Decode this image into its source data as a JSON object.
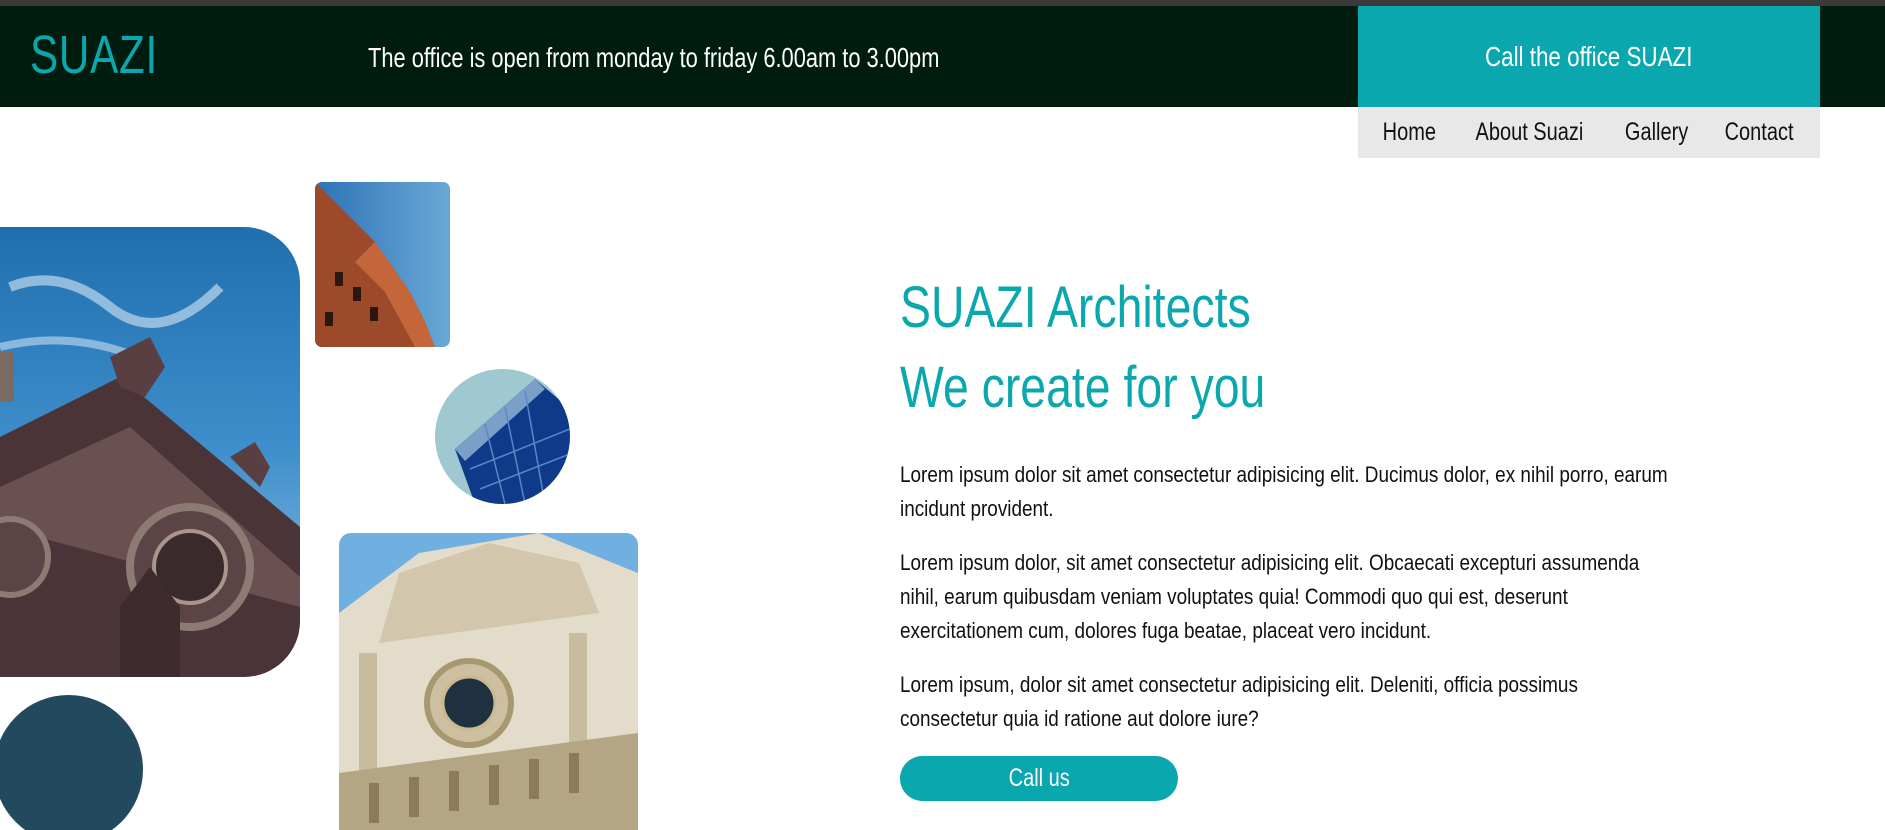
{
  "header": {
    "logo": "SUAZI",
    "hours": "The office is open from monday to friday 6.00am to 3.00pm",
    "call_office": "Call the office SUAZI"
  },
  "nav": {
    "items": [
      "Home",
      "About Suazi",
      "Gallery",
      "Contact"
    ]
  },
  "hero": {
    "title_line1": "SUAZI Architects",
    "title_line2": "We create for you",
    "paragraphs": [
      "Lorem ipsum dolor sit amet consectetur adipisicing elit. Ducimus dolor, ex nihil porro, earum incidunt provident.",
      "Lorem ipsum dolor, sit amet consectetur adipisicing elit. Obcaecati excepturi assumenda nihil, earum quibusdam veniam voluptates quia! Commodi quo qui est, deserunt exercitationem cum, dolores fuga beatae, placeat vero incidunt.",
      "Lorem ipsum, dolor sit amet consectetur adipisicing elit. Deleniti, officia possimus consectetur quia id ratione aut dolore iure?"
    ],
    "call_us": "Call us"
  },
  "colors": {
    "accent": "#0aa8ae",
    "header_bg": "#001c0f",
    "nav_bg": "#e8e8e8",
    "dark_circle": "#23495f"
  }
}
